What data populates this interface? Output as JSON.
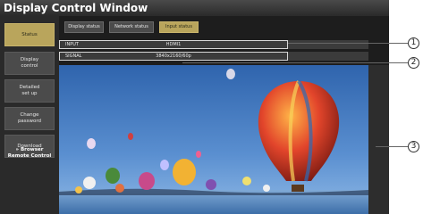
{
  "window": {
    "title": "Display Control Window"
  },
  "sidebar": {
    "items": [
      {
        "label": "Status",
        "active": true
      },
      {
        "label": "Display\ncontrol",
        "active": false
      },
      {
        "label": "Detailed\nset up",
        "active": false
      },
      {
        "label": "Change\npassword",
        "active": false
      },
      {
        "label": "Download",
        "active": false
      },
      {
        "label": "» Browser\nRemote Control",
        "active": false
      }
    ]
  },
  "tabs": [
    {
      "label": "Display status",
      "active": false
    },
    {
      "label": "Network status",
      "active": false
    },
    {
      "label": "Input status",
      "active": true
    }
  ],
  "input_status": {
    "input_label": "INPUT",
    "input_value": "HDMI1",
    "signal_label": "SIGNAL",
    "signal_value": "3840x2160/60p"
  },
  "callouts": [
    "1",
    "2",
    "3"
  ],
  "colors": {
    "active_tab": "#b9a55c",
    "inactive_tab": "#4b4b4b",
    "background": "#1d1d1d"
  }
}
